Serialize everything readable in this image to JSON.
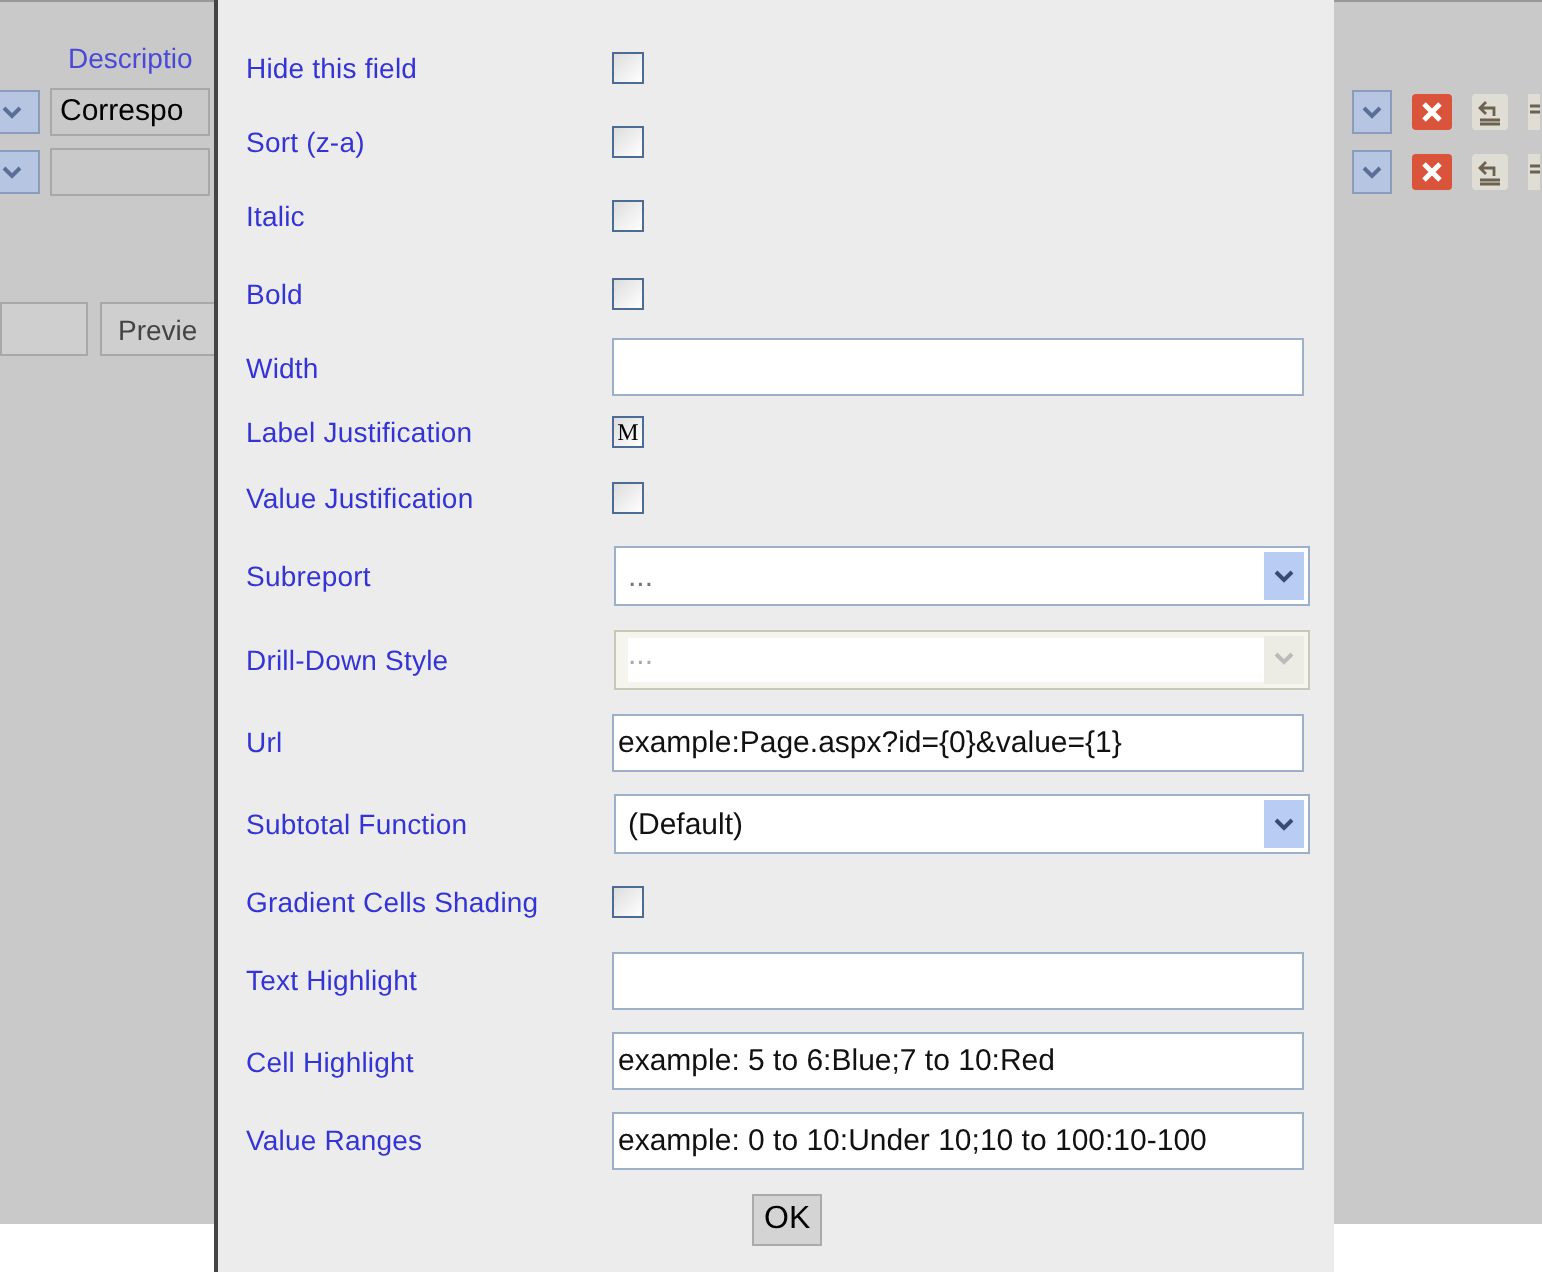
{
  "background": {
    "column_label": "Descriptio",
    "rows": [
      {
        "value": "Correspo"
      },
      {
        "value": ""
      }
    ],
    "button": "Previe"
  },
  "dialog": {
    "fields": [
      {
        "label": "Hide this field",
        "kind": "checkbox",
        "checked": false
      },
      {
        "label": "Sort (z-a)",
        "kind": "checkbox",
        "checked": false
      },
      {
        "label": "Italic",
        "kind": "checkbox",
        "checked": false
      },
      {
        "label": "Bold",
        "kind": "checkbox",
        "checked": false
      },
      {
        "label": "Width",
        "kind": "text"
      },
      {
        "label": "Label Justification",
        "kind": "checkbox",
        "checked": true,
        "glyph": "M"
      },
      {
        "label": "Value Justification",
        "kind": "checkbox",
        "checked": false
      },
      {
        "label": "Subreport",
        "kind": "select",
        "value": "...",
        "disabled": false
      },
      {
        "label": "Drill-Down Style",
        "kind": "select",
        "value": "...",
        "disabled": true
      },
      {
        "label": "Url",
        "kind": "text",
        "value": "example:Page.aspx?id={0}&value={1}"
      },
      {
        "label": "Subtotal Function",
        "kind": "select",
        "value": "(Default)",
        "disabled": false
      },
      {
        "label": "Gradient Cells Shading",
        "kind": "checkbox",
        "checked": false
      },
      {
        "label": "Text Highlight",
        "kind": "text"
      },
      {
        "label": "Cell Highlight",
        "kind": "text",
        "value": "example: 5 to 6:Blue;7 to 10:Red"
      },
      {
        "label": "Value Ranges",
        "kind": "text",
        "value": "example: 0 to 10:Under 10;10 to 100:10-100"
      }
    ],
    "ok_button": "OK"
  }
}
